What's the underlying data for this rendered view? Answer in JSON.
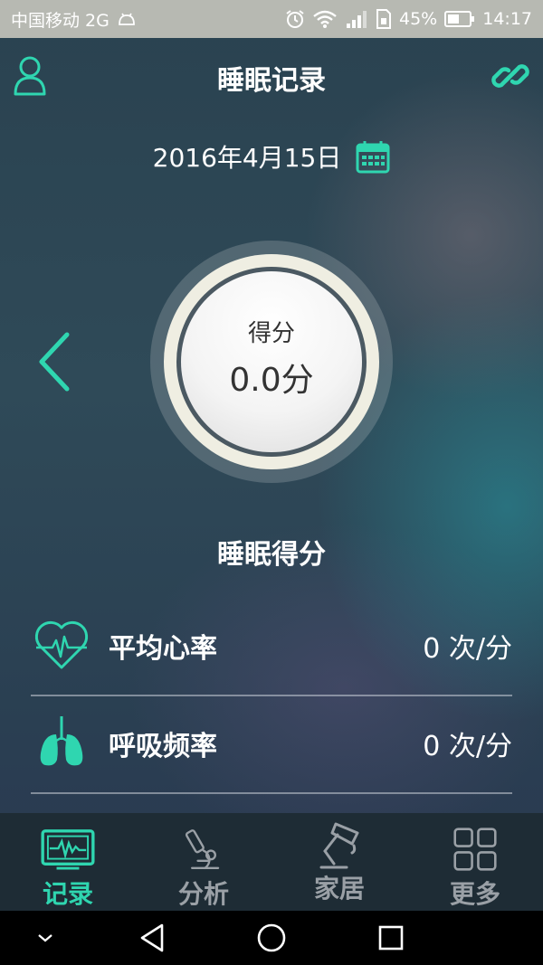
{
  "status_bar": {
    "carrier": "中国移动 2G",
    "battery": "45%",
    "time": "14:17"
  },
  "header": {
    "title": "睡眠记录"
  },
  "date": {
    "value": "2016年4月15日"
  },
  "score": {
    "label": "得分",
    "value": "0.0分",
    "caption": "睡眠得分"
  },
  "metrics": [
    {
      "label": "平均心率",
      "value": "0 次/分",
      "icon": "heart-rate-icon"
    },
    {
      "label": "呼吸频率",
      "value": "0 次/分",
      "icon": "lungs-icon"
    }
  ],
  "tabs": [
    {
      "label": "记录",
      "icon": "monitor-icon",
      "active": true
    },
    {
      "label": "分析",
      "icon": "microscope-icon",
      "active": false
    },
    {
      "label": "家居",
      "icon": "lamp-icon",
      "active": false
    },
    {
      "label": "更多",
      "icon": "grid-icon",
      "active": false
    }
  ],
  "colors": {
    "accent": "#2fd6b0",
    "tab_inactive": "#9aa0a6",
    "status_bar": "#b7b9b2"
  }
}
